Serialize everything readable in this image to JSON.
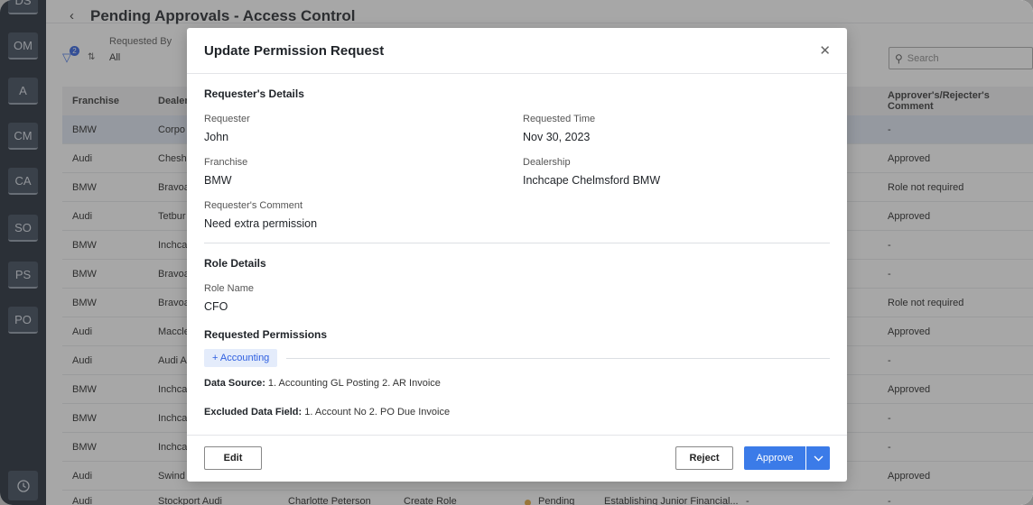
{
  "rail": {
    "items": [
      "DS",
      "OM",
      "A",
      "CM",
      "CA",
      "SO",
      "PS",
      "PO"
    ]
  },
  "page": {
    "title": "Pending Approvals - Access Control"
  },
  "filters": {
    "badge_count": "2",
    "requested_by_label": "Requested By",
    "requested_by_value": "All",
    "search_placeholder": "Search"
  },
  "table": {
    "headers": {
      "franchise": "Franchise",
      "dealership": "Dealer",
      "comment": "Approver's/Rejecter's Comment"
    },
    "rows": [
      {
        "franchise": "BMW",
        "dealership": "Corpo",
        "comment": "-"
      },
      {
        "franchise": "Audi",
        "dealership": "Chesh",
        "comment": "Approved"
      },
      {
        "franchise": "BMW",
        "dealership": "Bravoa",
        "comment": "Role not required"
      },
      {
        "franchise": "Audi",
        "dealership": "Tetbur",
        "comment": "Approved"
      },
      {
        "franchise": "BMW",
        "dealership": "Inchca",
        "comment": "-"
      },
      {
        "franchise": "BMW",
        "dealership": "Bravoa",
        "comment": "-"
      },
      {
        "franchise": "BMW",
        "dealership": "Bravoa",
        "comment": "Role not required"
      },
      {
        "franchise": "Audi",
        "dealership": "Maccle",
        "comment": "Approved"
      },
      {
        "franchise": "Audi",
        "dealership": "Audi A",
        "comment": "-"
      },
      {
        "franchise": "BMW",
        "dealership": "Inchca",
        "comment": "Approved"
      },
      {
        "franchise": "BMW",
        "dealership": "Inchca",
        "comment": "-"
      },
      {
        "franchise": "BMW",
        "dealership": "Inchca",
        "comment": "-"
      },
      {
        "franchise": "Audi",
        "dealership": "Swind",
        "comment": "Approved"
      }
    ],
    "bottom_row": {
      "franchise": "Audi",
      "dealership": "Stockport Audi",
      "requester": "Charlotte Peterson",
      "request_type": "Create Role",
      "status": "Pending",
      "role": "Establishing Junior Financial...",
      "dash": "-",
      "comment": "-"
    }
  },
  "modal": {
    "title": "Update Permission Request",
    "requester_details_title": "Requester's Details",
    "requester_label": "Requester",
    "requester_value": "John",
    "requested_time_label": "Requested Time",
    "requested_time_value": "Nov 30, 2023",
    "franchise_label": "Franchise",
    "franchise_value": "BMW",
    "dealership_label": "Dealership",
    "dealership_value": "Inchcape Chelmsford BMW",
    "requester_comment_label": "Requester's Comment",
    "requester_comment_value": "Need extra permission",
    "role_details_title": "Role Details",
    "role_name_label": "Role Name",
    "role_name_value": "CFO",
    "requested_permissions_title": "Requested Permissions",
    "permission_chip": "+ Accounting",
    "data_source_label": "Data Source:",
    "data_source_value": "1. Accounting GL Posting  2. AR Invoice",
    "excluded_label": "Excluded Data Field:",
    "excluded_value": "1. Account No  2. PO Due Invoice",
    "edit_label": "Edit",
    "reject_label": "Reject",
    "approve_label": "Approve"
  },
  "colors": {
    "accent": "#3b7be8",
    "rail_bg": "#1e2733",
    "status_pending": "#e5a63a"
  }
}
